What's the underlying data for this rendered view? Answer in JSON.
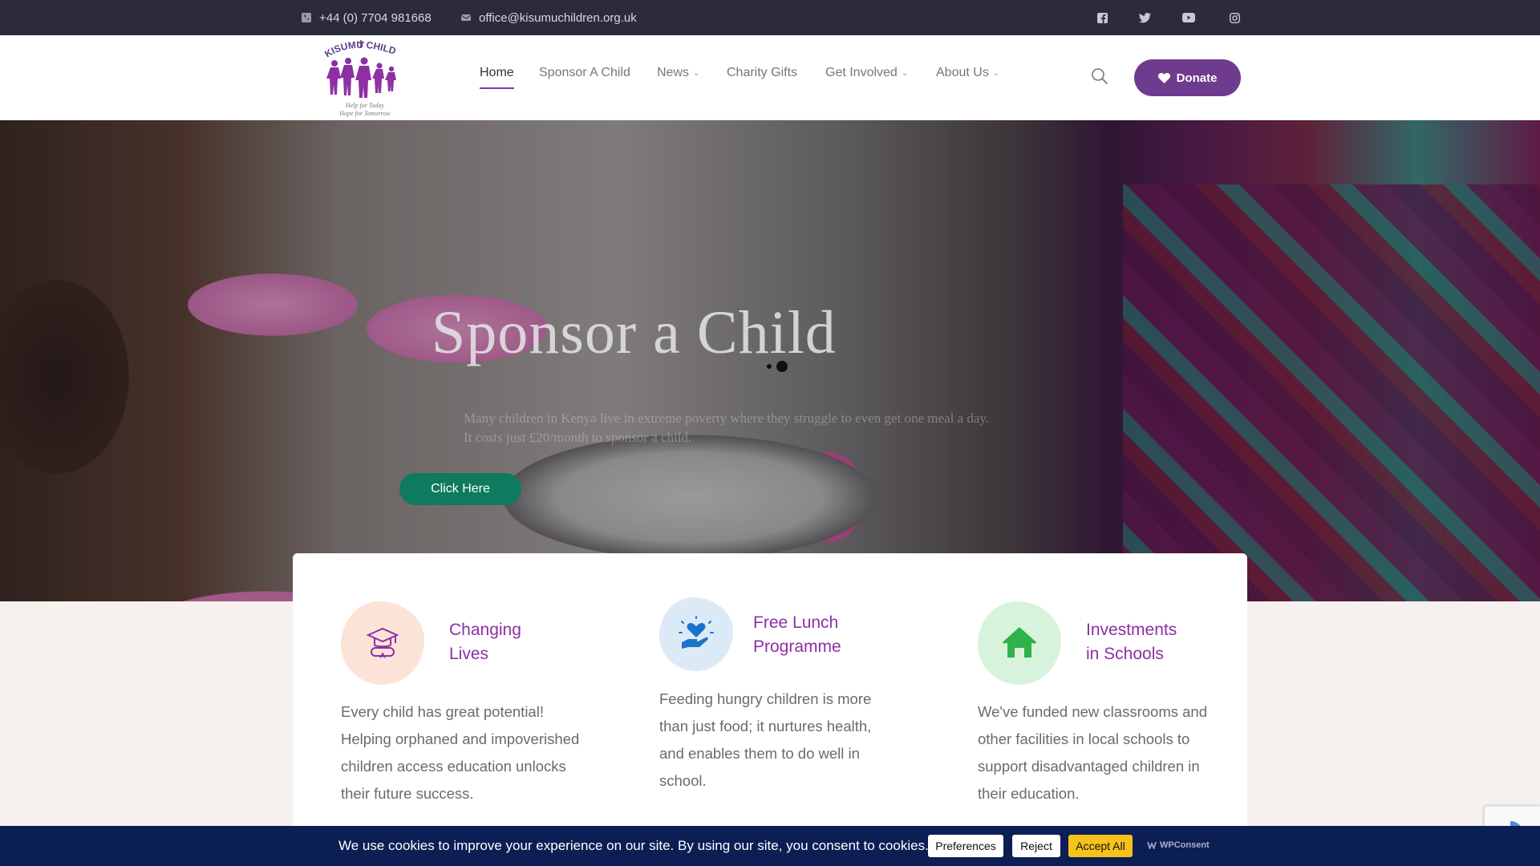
{
  "topbar": {
    "phone": "+44 (0) 7704 981668",
    "email": "office@kisumuchildren.org.uk",
    "social_icons": [
      "facebook-icon",
      "twitter-icon",
      "youtube-icon",
      "instagram-icon"
    ]
  },
  "logo": {
    "name": "KISUMU CHILDREN",
    "tagline_1": "Help for Today",
    "tagline_2": "Hope for Tomorrow"
  },
  "nav": {
    "items": [
      {
        "label": "Home",
        "active": true
      },
      {
        "label": "Sponsor A Child"
      },
      {
        "label": "News",
        "dropdown": true
      },
      {
        "label": "Charity Gifts"
      },
      {
        "label": "Get Involved",
        "dropdown": true
      },
      {
        "label": "About Us",
        "dropdown": true
      }
    ],
    "donate_label": "Donate"
  },
  "hero": {
    "title": "Sponsor a Child",
    "text_line1": "Many children in Kenya live in extreme poverty where they struggle to even get one meal a day.",
    "text_line2": "It costs just £20/month to sponsor a child.",
    "button_label": "Click Here"
  },
  "cards": [
    {
      "title_1": "Changing",
      "title_2": "Lives",
      "icon": "graduation-icon",
      "text": [
        "Every child has great potential!",
        "Helping orphaned and impoverished",
        "children access education unlocks",
        "their future success."
      ]
    },
    {
      "title_1": "Free Lunch",
      "title_2": "Programme",
      "icon": "heart-hand-icon",
      "text": [
        "Feeding hungry children is more",
        "than just food; it nurtures health,",
        "and enables them to do well in",
        "school."
      ]
    },
    {
      "title_1": "Investments",
      "title_2": "in Schools",
      "icon": "house-icon",
      "text": [
        "We've funded new classrooms and",
        "other facilities in local schools to",
        "support disadvantaged children in",
        "their education."
      ]
    }
  ],
  "cookie": {
    "message": "We use cookies to improve your experience on our site. By using our site, you consent to cookies.",
    "preferences": "Preferences",
    "reject": "Reject",
    "accept": "Accept All",
    "brand": "WPConsent"
  },
  "colors": {
    "topbar": "#2c2b3a",
    "accent_purple": "#6e3b8e",
    "title_purple": "#8e2fa5",
    "hero_button": "#0e7a5e",
    "cookie_bar": "#0b1f55",
    "accept_button": "#f7c21b"
  }
}
